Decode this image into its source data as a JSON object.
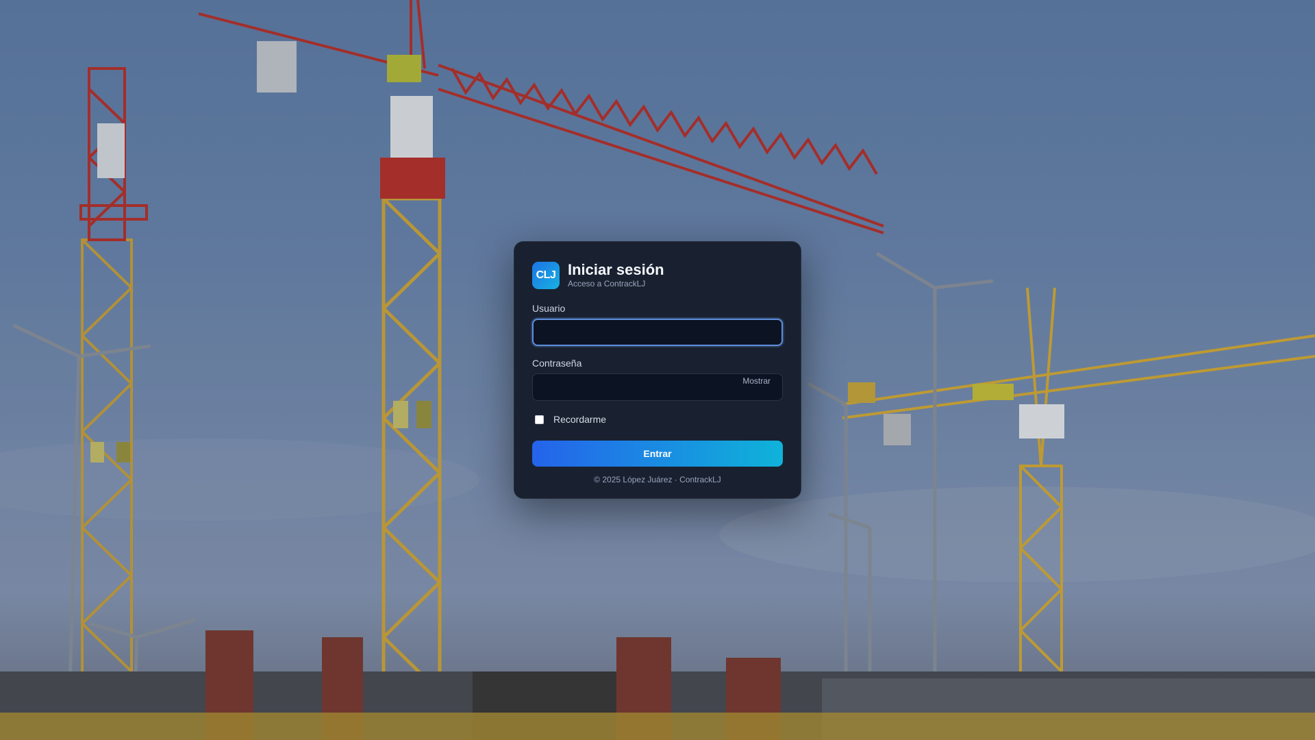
{
  "login": {
    "logo_text": "CLJ",
    "title": "Iniciar sesión",
    "subtitle": "Acceso a ContrackLJ",
    "username_label": "Usuario",
    "username_value": "",
    "password_label": "Contraseña",
    "password_value": "",
    "show_label": "Mostrar",
    "remember_label": "Recordarme",
    "remember_checked": false,
    "submit_label": "Entrar",
    "footer": "© 2025 López Juárez · ContrackLJ"
  },
  "colors": {
    "card_bg": "#161d2c",
    "accent_start": "#2563eb",
    "accent_end": "#0fb3d9",
    "focus_border": "#5e8fdc"
  },
  "background": {
    "description_icon": "construction-site-photo"
  }
}
